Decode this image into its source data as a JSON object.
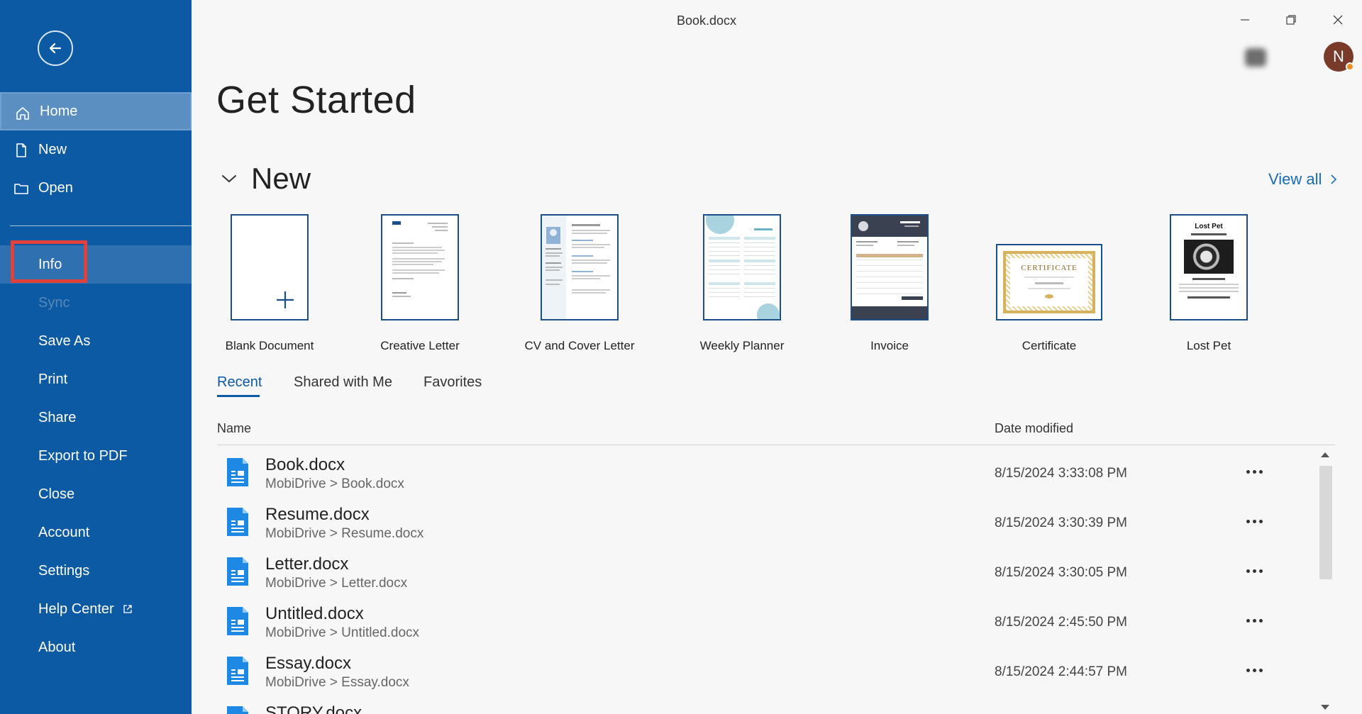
{
  "window": {
    "title": "Book.docx",
    "avatar_initial": "N"
  },
  "sidebar": {
    "items": [
      {
        "label": "Home",
        "icon": "home-icon",
        "state": "active"
      },
      {
        "label": "New",
        "icon": "new-doc-icon"
      },
      {
        "label": "Open",
        "icon": "folder-icon"
      },
      {
        "label": "Info",
        "state": "highlighted"
      },
      {
        "label": "Sync",
        "state": "disabled"
      },
      {
        "label": "Save As"
      },
      {
        "label": "Print"
      },
      {
        "label": "Share"
      },
      {
        "label": "Export to PDF"
      },
      {
        "label": "Close"
      },
      {
        "label": "Account"
      },
      {
        "label": "Settings"
      },
      {
        "label": "Help Center",
        "icon": "external-link-icon"
      },
      {
        "label": "About"
      }
    ]
  },
  "main": {
    "title": "Get Started",
    "new_section": {
      "title": "New",
      "view_all": "View all",
      "templates": [
        {
          "label": "Blank Document"
        },
        {
          "label": "Creative Letter"
        },
        {
          "label": "CV and Cover Letter"
        },
        {
          "label": "Weekly Planner"
        },
        {
          "label": "Invoice"
        },
        {
          "label": "Certificate",
          "thumb_text": "CERTIFICATE"
        },
        {
          "label": "Lost Pet",
          "thumb_text": "Lost Pet"
        }
      ]
    },
    "tabs": [
      {
        "label": "Recent",
        "active": true
      },
      {
        "label": "Shared with Me"
      },
      {
        "label": "Favorites"
      }
    ],
    "columns": {
      "name": "Name",
      "date": "Date modified"
    },
    "files": [
      {
        "name": "Book.docx",
        "path": "MobiDrive > Book.docx",
        "date": "8/15/2024 3:33:08 PM"
      },
      {
        "name": "Resume.docx",
        "path": "MobiDrive > Resume.docx",
        "date": "8/15/2024 3:30:39 PM"
      },
      {
        "name": "Letter.docx",
        "path": "MobiDrive > Letter.docx",
        "date": "8/15/2024 3:30:05 PM"
      },
      {
        "name": "Untitled.docx",
        "path": "MobiDrive > Untitled.docx",
        "date": "8/15/2024 2:45:50 PM"
      },
      {
        "name": "Essay.docx",
        "path": "MobiDrive > Essay.docx",
        "date": "8/15/2024 2:44:57 PM"
      },
      {
        "name": "STORY.docx",
        "path": "",
        "date": ""
      }
    ]
  },
  "colors": {
    "sidebar": "#0b5aa3",
    "accent": "#0b5aa3",
    "highlight": "#e0413b",
    "file_icon": "#1e88e5"
  }
}
